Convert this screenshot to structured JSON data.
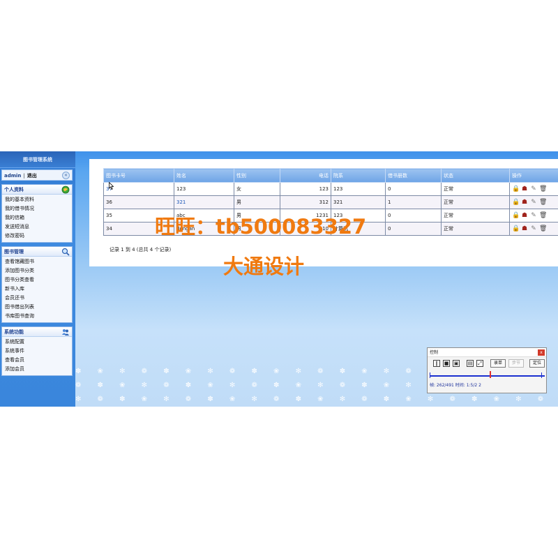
{
  "sidebar": {
    "app_title": "图书管理系统",
    "username": "admin",
    "separator": "|",
    "logout": "退出",
    "collapse_glyph": "«",
    "sections": [
      {
        "title": "个人资料",
        "icon": "globe-icon",
        "items": [
          "我的基本资料",
          "我的借书情况",
          "我的信箱",
          "发送短消息",
          "修改密码"
        ]
      },
      {
        "title": "图书管理",
        "icon": "magnifier-icon",
        "items": [
          "查看馆藏图书",
          "添加图书分类",
          "图书分类查看",
          "新书入库",
          "会员还书",
          "图书借出列表",
          "书库图书查询"
        ]
      },
      {
        "title": "系统功能",
        "icon": "users-icon",
        "items": [
          "系统配置",
          "系统事件",
          "查看会员",
          "添加会员"
        ]
      }
    ]
  },
  "grid": {
    "columns": [
      "图书卡号",
      "姓名",
      "性别",
      "电话",
      "院系",
      "借书册数",
      "状态",
      "操作"
    ],
    "rows": [
      {
        "id": "37",
        "name": "123",
        "gender": "女",
        "phone": "123",
        "dept": "123",
        "borrowed": "0",
        "status": "正常"
      },
      {
        "id": "36",
        "name": "321",
        "gender": "男",
        "phone": "312",
        "dept": "321",
        "borrowed": "1",
        "status": "正常"
      },
      {
        "id": "35",
        "name": "abc",
        "gender": "男",
        "phone": "1231",
        "dept": "123",
        "borrowed": "0",
        "status": "正常"
      },
      {
        "id": "34",
        "name": "dongan",
        "gender": "男",
        "phone": "10",
        "dept": "计算机",
        "borrowed": "0",
        "status": "正常"
      }
    ],
    "op_icons": [
      "lock-icon",
      "user-icon",
      "edit-icon",
      "trash-icon"
    ],
    "pager": "记录 1 到 4 (总共 4 个记录)"
  },
  "watermark": {
    "line1": "旺旺：tb500083327",
    "line2": "大通设计"
  },
  "control_dialog": {
    "title": "控制",
    "close": "x",
    "btn_record": "录单",
    "btn_step": "步节",
    "btn_locate": "定位",
    "status": "帧: 262/491  时间: 1:5/2 2"
  },
  "colors": {
    "watermark": "#f07a10",
    "sidebar_bg": "#3a86dc",
    "header_bg": "#6ea4e6",
    "link": "#1a56b8"
  }
}
